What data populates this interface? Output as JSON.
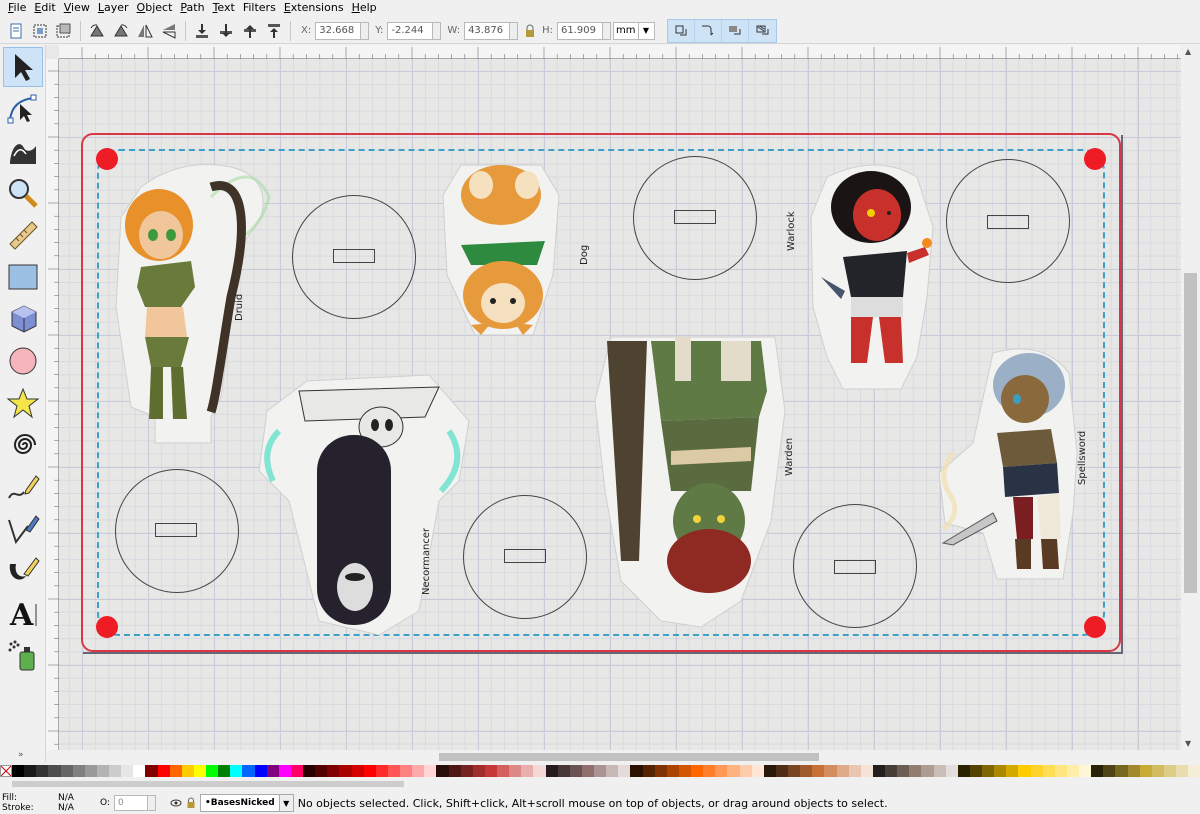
{
  "menu": {
    "items": [
      {
        "key": "F",
        "rest": "ile"
      },
      {
        "key": "E",
        "rest": "dit"
      },
      {
        "key": "V",
        "rest": "iew"
      },
      {
        "key": "L",
        "rest": "ayer"
      },
      {
        "key": "O",
        "rest": "bject"
      },
      {
        "key": "P",
        "rest": "ath"
      },
      {
        "key": "T",
        "rest": "ext"
      },
      {
        "key": "",
        "rest": "Filters"
      },
      {
        "key": "E",
        "rest": "xtensions"
      },
      {
        "key": "H",
        "rest": "elp"
      }
    ]
  },
  "toolbar": {
    "x_label": "X:",
    "x_value": "32.668",
    "y_label": "Y:",
    "y_value": "-2.244",
    "w_label": "W:",
    "w_value": "43.876",
    "h_label": "H:",
    "h_value": "61.909",
    "unit": "mm"
  },
  "canvas": {
    "labels": {
      "druid": "Druid",
      "dog": "Dog",
      "warlock": "Warlock",
      "necromancer": "Necormancer",
      "warden": "Warden",
      "spellsword": "Spellsword"
    }
  },
  "colors": {
    "sheet_border": "#d93646",
    "pin": "#ee1c25",
    "dash": "#3da0c8",
    "selection": "#cfe3f7"
  },
  "statusbar": {
    "fill_label": "Fill:",
    "fill_value": "N/A",
    "stroke_label": "Stroke:",
    "stroke_value": "N/A",
    "opacity_label": "O:",
    "opacity_value": "0",
    "layer_name": "•BasesNicked",
    "message": "No objects selected. Click, Shift+click, Alt+scroll mouse on top of objects, or drag around objects to select."
  },
  "palette": [
    "#000000",
    "#1a1a1a",
    "#333333",
    "#4d4d4d",
    "#666666",
    "#808080",
    "#999999",
    "#b3b3b3",
    "#cccccc",
    "#e6e6e6",
    "#ffffff",
    "#800000",
    "#ff0000",
    "#ff6600",
    "#ffcc00",
    "#ffff00",
    "#00ff00",
    "#008000",
    "#00ffff",
    "#0066ff",
    "#0000ff",
    "#800080",
    "#ff00ff",
    "#ff0066",
    "#2b0000",
    "#550000",
    "#800000",
    "#aa0000",
    "#d40000",
    "#ff0000",
    "#ff2a2a",
    "#ff5555",
    "#ff8080",
    "#ffaaaa",
    "#ffd5d5",
    "#280b0b",
    "#501616",
    "#782121",
    "#a02c2c",
    "#c83737",
    "#d35f5f",
    "#de8787",
    "#e9afaf",
    "#f4d7d7",
    "#241c1c",
    "#483737",
    "#6c5353",
    "#916f6f",
    "#ac9393",
    "#c8b7b7",
    "#e3dbdb",
    "#2b1100",
    "#552200",
    "#803300",
    "#aa4400",
    "#d45500",
    "#ff6600",
    "#ff7f2a",
    "#ff9955",
    "#ffb380",
    "#ffccaa",
    "#ffe6d5",
    "#28170b",
    "#502d16",
    "#784421",
    "#a05a2c",
    "#c87137",
    "#d38d5f",
    "#deaa87",
    "#e9c6af",
    "#f4e3d7",
    "#241f1c",
    "#483e37",
    "#6c5d53",
    "#917c6f",
    "#ac9d93",
    "#c8beb7",
    "#e3dedb",
    "#2b2200",
    "#554400",
    "#806600",
    "#aa8800",
    "#d4aa00",
    "#ffcc00",
    "#ffd42a",
    "#ffdd55",
    "#ffe680",
    "#ffeeaa",
    "#fff6d5",
    "#28220b",
    "#504416",
    "#786721",
    "#a0892c",
    "#c8ab37",
    "#d3bc5f",
    "#decd87",
    "#e9ddaf",
    "#f4eed7"
  ]
}
